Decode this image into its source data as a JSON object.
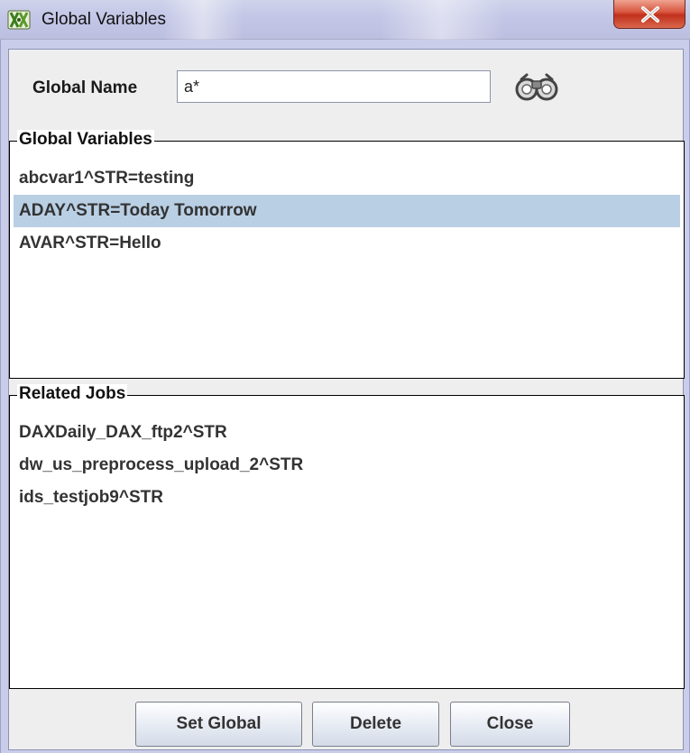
{
  "window": {
    "title": "Global Variables",
    "app_icon": "green-x-app-icon",
    "close_icon": "close-x-icon"
  },
  "search": {
    "label": "Global Name",
    "value": "a*",
    "button_icon": "binoculars-icon"
  },
  "global_variables": {
    "legend": "Global Variables",
    "items": [
      {
        "label": "abcvar1^STR=testing",
        "selected": false
      },
      {
        "label": "ADAY^STR=Today Tomorrow",
        "selected": true
      },
      {
        "label": "AVAR^STR=Hello",
        "selected": false
      }
    ]
  },
  "related_jobs": {
    "legend": "Related Jobs",
    "items": [
      {
        "label": "DAXDaily_DAX_ftp2^STR"
      },
      {
        "label": "dw_us_preprocess_upload_2^STR"
      },
      {
        "label": "ids_testjob9^STR"
      }
    ]
  },
  "buttons": {
    "set_global": "Set Global",
    "delete": "Delete",
    "close": "Close"
  },
  "colors": {
    "selection": "#b9cfe4",
    "title_bar": "#c3c6e6",
    "close_button": "#c1301c",
    "panel_bg": "#eeeeee"
  }
}
